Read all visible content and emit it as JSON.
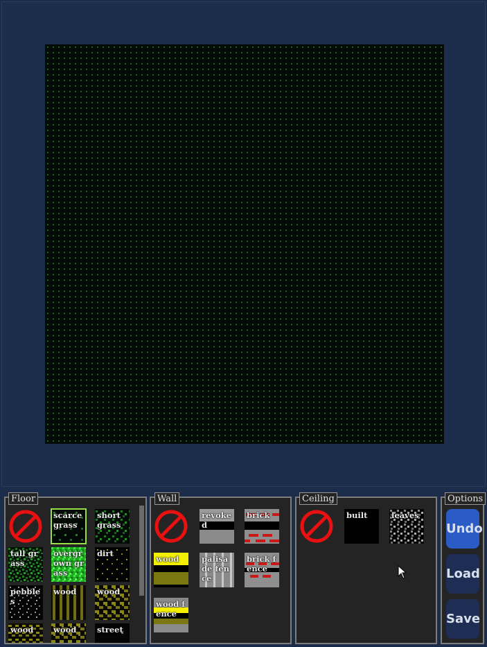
{
  "panels": {
    "floor": {
      "title": "Floor",
      "tiles": [
        {
          "label": "scarce grass",
          "selected": true
        },
        {
          "label": "short grass"
        },
        {
          "label": "tall grass"
        },
        {
          "label": "overgrown grass"
        },
        {
          "label": "dirt"
        },
        {
          "label": "pebbles"
        },
        {
          "label": "wood"
        },
        {
          "label": "wood"
        },
        {
          "label": "wood"
        },
        {
          "label": "wood"
        },
        {
          "label": "street"
        }
      ]
    },
    "wall": {
      "title": "Wall",
      "tiles": [
        {
          "label": "revoked"
        },
        {
          "label": "brick"
        },
        {
          "label": "wood"
        },
        {
          "label": "palisade fence"
        },
        {
          "label": "brick fence"
        },
        {
          "label": "wood fence"
        }
      ]
    },
    "ceiling": {
      "title": "Ceiling",
      "tiles": [
        {
          "label": "built"
        },
        {
          "label": "leaves"
        }
      ]
    },
    "options": {
      "title": "Options",
      "undo_label": "Undo",
      "load_label": "Load",
      "save_label": "Save"
    }
  },
  "colors": {
    "background": "#1c2c4b",
    "grid_dot": "#1f7a2c",
    "selection": "#98e048",
    "no_symbol": "#e81010",
    "active_button": "#2b5bc4"
  }
}
